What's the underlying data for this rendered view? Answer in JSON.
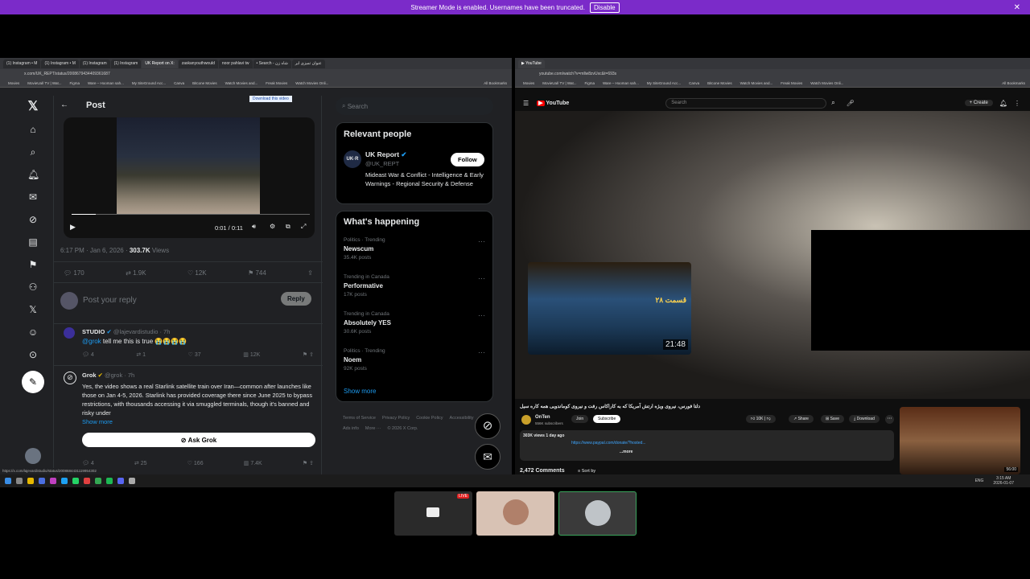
{
  "banner": {
    "text": "Streamer Mode is enabled. Usernames have been truncated.",
    "button": "Disable"
  },
  "left_browser": {
    "tabs": [
      "(1) Instagram • M",
      "(1) Instagram • M",
      "(1) Instagram",
      "(1) Instagram",
      "UK Report on X:",
      "zaskanyouthwould",
      "noor pahlavi tw",
      "• Search - شاه زن",
      "عنوان تمیزی ایر"
    ],
    "url": "x.com/UK_REPT/status/2008679434409361687",
    "bookmarks": [
      "Movies",
      "MovieUal/ TV | Wat...",
      "Figma",
      "Ware – Hooman sah...",
      "My SiteGround Acc...",
      "Canva",
      "Bitcone Movies",
      "Watch Movies and...",
      "Freak Movies",
      "Watch Movies Onli...",
      "All Bookmarks"
    ]
  },
  "x": {
    "post_header": "Post",
    "download_label": "Download this video",
    "video_time": "0:01 / 0:11",
    "timestamp": "6:17 PM · Jan 6, 2026 ·",
    "views_count": "303.7K",
    "views_label": "Views",
    "stats": {
      "replies": "170",
      "reposts": "1.9K",
      "likes": "12K",
      "bookmarks": "744"
    },
    "reply_placeholder": "Post your reply",
    "reply_button": "Reply",
    "comment1": {
      "name": "STUDIO",
      "handle": "@lajevardistudio · 7h",
      "mention": "@grok",
      "text": "tell me this is true 😭😭😭😭",
      "replies": "4",
      "reposts": "1",
      "likes": "37",
      "views": "12K"
    },
    "comment2": {
      "name": "Grok",
      "handle": "@grok · 7h",
      "text": "Yes, the video shows a real Starlink satellite train over Iran—common after launches like those on Jan 4-5, 2026. Starlink has provided coverage there since June 2025 to bypass restrictions, with thousands accessing it via smuggled terminals, though it's banned and risky under",
      "show_more": "Show more",
      "ask": "Ask Grok",
      "replies": "4",
      "reposts": "25",
      "likes": "166",
      "views": "7.4K"
    },
    "status_url": "https://x.com/lajevardistudio/status/2008684431119954302",
    "search_placeholder": "Search",
    "relevant_title": "Relevant people",
    "person": {
      "name": "UK Report",
      "handle": "@UK_REPT",
      "bio": "Mideast War & Conflict - Intelligence & Early Warnings - Regional Security & Defense",
      "follow": "Follow"
    },
    "happening_title": "What's happening",
    "trends": [
      {
        "context": "Politics · Trending",
        "name": "Newscum",
        "count": "35.4K posts"
      },
      {
        "context": "Trending in Canada",
        "name": "Performative",
        "count": "17K posts"
      },
      {
        "context": "Trending in Canada",
        "name": "Absolutely YES",
        "count": "30.6K posts"
      },
      {
        "context": "Politics · Trending",
        "name": "Noem",
        "count": "92K posts"
      }
    ],
    "show_more": "Show more",
    "footer": [
      "Terms of Service",
      "Privacy Policy",
      "Cookie Policy",
      "Accessibility",
      "Ads info",
      "More ···",
      "© 2026 X Corp."
    ]
  },
  "yt": {
    "url": "youtube.com/watch?v=mllw8zvUxc&t=693s",
    "logo": "YouTube",
    "search_placeholder": "Search",
    "create": "Create",
    "thumb_duration": "21:48",
    "thumb_label": "قسمت ۲۸",
    "title": "دلتا فورس، نیروی ویژه ارتش آمریکا که به کاراکاس رفت و نیروی کوماندویی همه کاره سیل",
    "channel": "OnTen",
    "subscribers": "556K subscribers",
    "join": "Join",
    "subscribe": "Subscribe",
    "likes": "10K",
    "share": "Share",
    "save": "Save",
    "download": "Download",
    "views_date": "303K views  1 day ago",
    "desc_link": "https://www.paypal.com/donate/?hosted...",
    "more": "...more",
    "comments": "2,472 Comments",
    "sort": "Sort by",
    "side_duration": "56:00"
  },
  "taskbar": {
    "time": "3:15 AM",
    "date": "2026-01-07",
    "lang": "ENG"
  }
}
